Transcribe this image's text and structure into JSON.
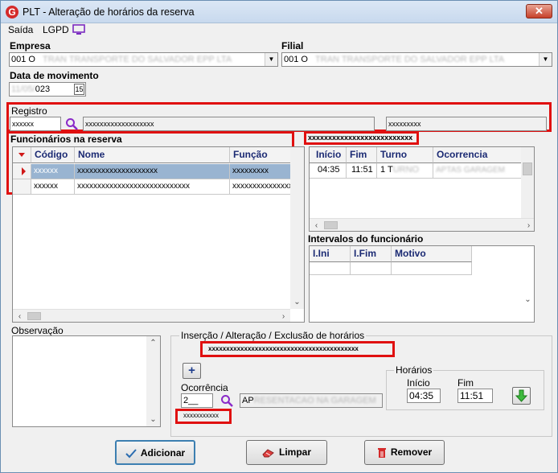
{
  "window": {
    "title": "PLT - Alteração de horários da reserva",
    "close_label": "✕"
  },
  "menu": {
    "saida": "Saída",
    "lgpd": "LGPD"
  },
  "empresa": {
    "label": "Empresa",
    "value": "001 O",
    "hidden_text": "TRAN TRANSPORTE DO SALVADOR EPP LTA"
  },
  "filial": {
    "label": "Filial",
    "value": "001 O",
    "hidden_text": "TRAN TRANSPORTE DO SALVADOR EPP LTA"
  },
  "data_movimento": {
    "label": "Data de movimento",
    "value_hidden": "11/05/",
    "value_visible": "023",
    "calendar": "15"
  },
  "registro": {
    "label": "Registro",
    "code": "xxxxxx",
    "name": "xxxxxxxxxxxxxxxxxxx",
    "extra": "xxxxxxxxx"
  },
  "func_reserva": {
    "title": "Funcionários na reserva",
    "columns": [
      "Código",
      "Nome",
      "Função"
    ],
    "rows": [
      {
        "codigo": "xxxxxx",
        "nome": "xxxxxxxxxxxxxxxxxxxx",
        "funcao": "xxxxxxxxx"
      },
      {
        "codigo": "xxxxxx",
        "nome": "xxxxxxxxxxxxxxxxxxxxxxxxxxxx",
        "funcao": "xxxxxxxxxxxxxxxx"
      }
    ]
  },
  "escala": {
    "title": "xxxxxxxxxxxxxxxxxxxxxxxxxx",
    "columns": [
      "Início",
      "Fim",
      "Turno",
      "Ocorrencia"
    ],
    "rows": [
      {
        "inicio": "04:35",
        "fim": "11:51",
        "turno": "1 T",
        "turno_hidden": "URNO",
        "ocorrencia_hidden": "APTAS GARAGEM"
      }
    ]
  },
  "intervalos": {
    "title": "Intervalos do funcionário",
    "columns": [
      "I.Ini",
      "I.Fim",
      "Motivo"
    ]
  },
  "observacao": {
    "label": "Observação"
  },
  "insercao": {
    "title": "Inserção / Alteração / Exclusão de horários",
    "banner": "xxxxxxxxxxxxxxxxxxxxxxxxxxxxxxxxxxxxxxxxxx",
    "add_icon": "+",
    "ocorrencia_label": "Ocorrência",
    "ocorrencia_code": "2__",
    "ocorrencia_desc_visible": "AP",
    "ocorrencia_desc_hidden": "RESENTACAO NA GARAGEM",
    "ocorrencia_note": "xxxxxxxxxxx",
    "horarios_title": "Horários",
    "inicio_label": "Início",
    "inicio_value": "04:35",
    "fim_label": "Fim",
    "fim_value": "11:51"
  },
  "buttons": {
    "adicionar": "Adicionar",
    "limpar": "Limpar",
    "remover": "Remover"
  },
  "colors": {
    "red_highlight": "#e01010",
    "header_text": "#1b2a73",
    "selection": "#99b4d1"
  }
}
